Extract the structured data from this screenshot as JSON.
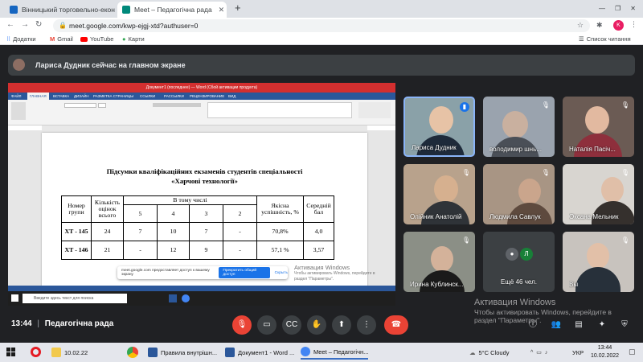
{
  "browser": {
    "tabs": [
      {
        "label": "Вінницький торговельно-екон",
        "active": false,
        "color": "#1565c0"
      },
      {
        "label": "Meet – Педагогічна рада",
        "active": true,
        "color": "#00897b"
      }
    ],
    "new_tab": "+",
    "url": "meet.google.com/kwp-ejgj-xtd?authuser=0",
    "profile_letter": "K",
    "bookmarks": {
      "apps": "Додатки",
      "gmail": "Gmail",
      "youtube": "YouTube",
      "maps": "Карти",
      "reading_list": "Список читання"
    }
  },
  "meet": {
    "presenter_text": "Лариса Дудник сейчас на главном экране",
    "time": "13:44",
    "separator": "|",
    "meeting_name": "Педагогічна рада",
    "accent": "#1a73e8",
    "hangup_color": "#ea4335",
    "participants": [
      {
        "name": "Лариса Дудник",
        "muted": false
      },
      {
        "name": "володимир шнь...",
        "muted": true
      },
      {
        "name": "Наталія Пасіч...",
        "muted": true
      },
      {
        "name": "Олійник Анатолій",
        "muted": true
      },
      {
        "name": "Людмила Савлук",
        "muted": true
      },
      {
        "name": "Оксана Мельник",
        "muted": true
      },
      {
        "name": "Ирина Кублинск...",
        "muted": true
      },
      {
        "name": "Ещё 46 чел.",
        "initial": "Л"
      },
      {
        "name": "Вы",
        "muted": true
      }
    ],
    "share_notice": {
      "text": "meet.google.com предоставляет доступ к вашему экрану",
      "stop": "Прекратить общий доступ",
      "hide": "Скрыть"
    }
  },
  "document": {
    "word_title": "Документ1 (последнее) — Word (Сбой активации продукта)",
    "word_tabs": [
      "ФАЙЛ",
      "ГЛАВНАЯ",
      "ВСТАВКА",
      "ДИЗАЙН",
      "РАЗМЕТКА СТРАНИЦЫ",
      "ССЫЛКИ",
      "РАССЫЛКИ",
      "РЕЦЕНЗИРОВАНИЕ",
      "ВИД"
    ],
    "heading_line1": "Підсумки кваліфікаційних екзаменів студентів спеціальності",
    "heading_line2": "«Харчові технології»",
    "table": {
      "h_group": "Номер групи",
      "h_count": "Кількість оцінок всього",
      "h_including": "В тому числі",
      "h_quality": "Якісна успішність, %",
      "h_avg": "Середній бал",
      "grades": [
        "5",
        "4",
        "3",
        "2"
      ],
      "rows": [
        {
          "group": "ХТ - 145",
          "count": "24",
          "g5": "7",
          "g4": "10",
          "g3": "7",
          "g2": "-",
          "quality": "70,8%",
          "avg": "4,0"
        },
        {
          "group": "ХТ - 146",
          "count": "21",
          "g5": "-",
          "g4": "12",
          "g3": "9",
          "g2": "-",
          "quality": "57,1 %",
          "avg": "3,57"
        }
      ]
    },
    "win_search": "Введите здесь текст для поиска",
    "inner_watermark_title": "Активация Windows",
    "inner_watermark_text": "Чтобы активировать Windows, перейдите в раздел \"Параметры\"."
  },
  "watermark": {
    "title": "Активация Windows",
    "line1": "Чтобы активировать Windows, перейдите в",
    "line2": "раздел \"Параметры\"."
  },
  "taskbar": {
    "items": [
      {
        "label": "10.02.22",
        "color": "#f2c94c"
      },
      {
        "label": "Правила внутрішн...",
        "color": "#2b579a"
      },
      {
        "label": "Документ1 - Word ...",
        "color": "#2b579a"
      },
      {
        "label": "Meet – Педагогічн...",
        "color": "#4285f4"
      }
    ],
    "weather": "5°C  Cloudy",
    "lang": "УКР",
    "clock_time": "13:44",
    "clock_date": "10.02.2022"
  }
}
